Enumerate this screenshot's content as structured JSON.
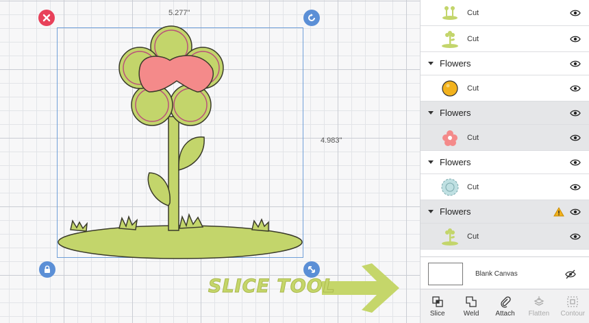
{
  "canvas": {
    "width_label": "5.277\"",
    "height_label": "4.983\"",
    "handles": {
      "delete": "close-icon",
      "rotate": "rotate-icon",
      "lock": "lock-icon",
      "resize": "resize-icon"
    },
    "annotation": "SLICE TOOL"
  },
  "layers": [
    {
      "kind": "item",
      "label": "Cut",
      "thumb": "grass-thumbnail",
      "shaded": false
    },
    {
      "kind": "item",
      "label": "Cut",
      "thumb": "flower-green-thumbnail",
      "shaded": false
    },
    {
      "kind": "group",
      "label": "Flowers",
      "shaded": false
    },
    {
      "kind": "item",
      "label": "Cut",
      "thumb": "orange-circle-thumbnail",
      "shaded": false
    },
    {
      "kind": "group",
      "label": "Flowers",
      "shaded": true
    },
    {
      "kind": "item",
      "label": "Cut",
      "thumb": "pink-flower-thumbnail",
      "shaded": true
    },
    {
      "kind": "group",
      "label": "Flowers",
      "shaded": false
    },
    {
      "kind": "item",
      "label": "Cut",
      "thumb": "blue-flower-thumbnail",
      "shaded": false
    },
    {
      "kind": "group",
      "label": "Flowers",
      "shaded": true,
      "warning": true
    },
    {
      "kind": "item",
      "label": "Cut",
      "thumb": "flower-green-thumbnail",
      "shaded": true
    }
  ],
  "blank_canvas": {
    "label": "Blank Canvas"
  },
  "toolbar": {
    "slice": "Slice",
    "weld": "Weld",
    "attach": "Attach",
    "flatten": "Flatten",
    "contour": "Contour"
  },
  "colors": {
    "green": "#c3d56b",
    "pink": "#f48a8a",
    "outline": "#3a3a2a",
    "delete_red": "#e8415a",
    "handle_blue": "#5b8fd6",
    "selection_blue": "#6f9fd8",
    "warning_yellow": "#f2b21d"
  }
}
